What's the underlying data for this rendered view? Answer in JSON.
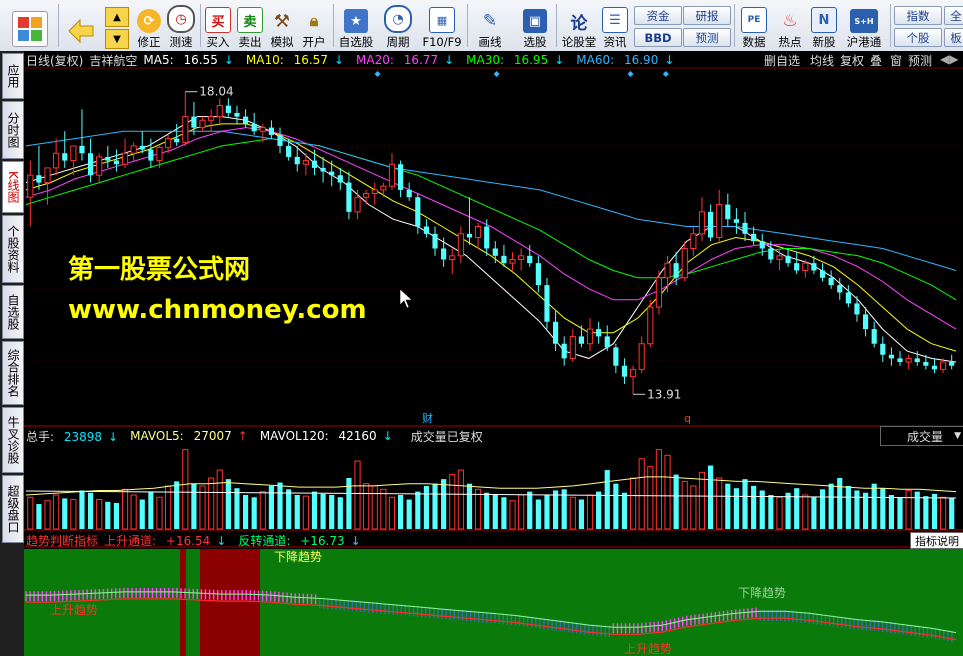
{
  "toolbar": {
    "main_menu": "",
    "buttons": [
      {
        "label": "",
        "icon": "back-icon"
      },
      {
        "label": "修正",
        "icon": "fix-icon"
      },
      {
        "label": "测速",
        "icon": "speedtest-icon"
      },
      {
        "label": "买入",
        "icon": "buy-icon",
        "glyph": "买"
      },
      {
        "label": "卖出",
        "icon": "sell-icon",
        "glyph": "卖"
      },
      {
        "label": "模拟",
        "icon": "hammer-icon"
      },
      {
        "label": "开户",
        "icon": "lock-icon"
      },
      {
        "label": "自选股",
        "icon": "star-icon"
      },
      {
        "label": "周期",
        "icon": "clock-icon"
      },
      {
        "label": "F10/F9",
        "icon": "f10-icon"
      },
      {
        "label": "画线",
        "icon": "pen-icon"
      },
      {
        "label": "选股",
        "icon": "select-icon"
      },
      {
        "label": "论股堂",
        "icon": "forum-icon",
        "glyph": "论"
      },
      {
        "label": "资讯",
        "icon": "news-icon"
      },
      {
        "label": "数据",
        "icon": "data-icon",
        "glyph": "PE"
      },
      {
        "label": "热点",
        "icon": "hot-icon"
      },
      {
        "label": "新股",
        "icon": "newstock-icon",
        "glyph": "N"
      },
      {
        "label": "沪港通",
        "icon": "hk-icon",
        "glyph": "S+H"
      }
    ],
    "small_buttons": [
      "资金",
      "研报",
      "BBD",
      "预测"
    ],
    "right_buttons": [
      "指数",
      "全",
      "个股",
      "板"
    ]
  },
  "left_tabs": [
    "应用",
    "分时图",
    "K线图",
    "个股资料",
    "自选股",
    "综合排名",
    "牛叉诊股",
    "超级盘口"
  ],
  "main": {
    "period": "日线(复权)",
    "stock": "吉祥航空",
    "ma": [
      {
        "label": "MA5:",
        "value": "16.55",
        "arrow": "↓",
        "color": "#ffffff"
      },
      {
        "label": "MA10:",
        "value": "16.57",
        "arrow": "↓",
        "color": "#ffff00"
      },
      {
        "label": "MA20:",
        "value": "16.77",
        "arrow": "↓",
        "color": "#ff44ff"
      },
      {
        "label": "MA30:",
        "value": "16.95",
        "arrow": "↓",
        "color": "#00ff00"
      },
      {
        "label": "MA60:",
        "value": "16.90",
        "arrow": "↓",
        "color": "#33b5ff"
      }
    ],
    "right_buttons": [
      "删自选",
      "均线",
      "复权",
      "叠",
      "窗",
      "预测"
    ],
    "high_label": "18.04",
    "low_label": "13.91",
    "marker_cai": "财",
    "marker_q": "q",
    "watermark_cn": "第一股票公式网",
    "watermark_url": "www.chnmoney.com"
  },
  "volume": {
    "total": {
      "label": "总手:",
      "value": "23898",
      "arrow": "↓"
    },
    "mavol5": {
      "label": "MAVOL5:",
      "value": "27007",
      "arrow": "↑"
    },
    "mavol120": {
      "label": "MAVOL120:",
      "value": "42160",
      "arrow": "↓"
    },
    "note": "成交量已复权",
    "selector": "成交量"
  },
  "indicator": {
    "name": "趋势判断指标",
    "up": {
      "label": "上升通道:",
      "value": "+16.54",
      "arrow": "↓"
    },
    "rev": {
      "label": "反转通道:",
      "value": "+16.73",
      "arrow": "↓"
    },
    "help": "指标说明",
    "labels": [
      "上升趋势",
      "下降趋势",
      "下降趋势",
      "上升趋势"
    ]
  },
  "chart_data": {
    "type": "candlestick",
    "price_range": [
      13.6,
      18.35
    ],
    "candles": [
      [
        16.6,
        17.1,
        16.2,
        16.9
      ],
      [
        16.9,
        17.3,
        16.7,
        16.8
      ],
      [
        16.8,
        17.0,
        16.5,
        17.0
      ],
      [
        17.0,
        17.4,
        16.9,
        17.2
      ],
      [
        17.2,
        17.5,
        17.0,
        17.1
      ],
      [
        17.1,
        17.3,
        16.9,
        17.3
      ],
      [
        17.3,
        17.8,
        17.1,
        17.2
      ],
      [
        17.2,
        17.4,
        16.8,
        16.9
      ],
      [
        16.9,
        17.2,
        16.8,
        17.15
      ],
      [
        17.15,
        17.3,
        17.0,
        17.1
      ],
      [
        17.1,
        17.25,
        16.95,
        17.05
      ],
      [
        17.05,
        17.4,
        17.0,
        17.2
      ],
      [
        17.2,
        17.35,
        17.1,
        17.3
      ],
      [
        17.3,
        17.5,
        17.2,
        17.25
      ],
      [
        17.25,
        17.4,
        17.0,
        17.1
      ],
      [
        17.1,
        17.3,
        17.0,
        17.28
      ],
      [
        17.28,
        17.45,
        17.2,
        17.4
      ],
      [
        17.4,
        17.6,
        17.3,
        17.35
      ],
      [
        17.35,
        18.04,
        17.3,
        17.7
      ],
      [
        17.7,
        17.9,
        17.45,
        17.55
      ],
      [
        17.55,
        17.7,
        17.5,
        17.65
      ],
      [
        17.65,
        17.8,
        17.5,
        17.7
      ],
      [
        17.7,
        17.95,
        17.6,
        17.85
      ],
      [
        17.85,
        17.95,
        17.7,
        17.75
      ],
      [
        17.75,
        17.85,
        17.6,
        17.7
      ],
      [
        17.7,
        17.8,
        17.55,
        17.6
      ],
      [
        17.6,
        17.75,
        17.45,
        17.5
      ],
      [
        17.5,
        17.6,
        17.35,
        17.55
      ],
      [
        17.55,
        17.65,
        17.4,
        17.45
      ],
      [
        17.45,
        17.55,
        17.2,
        17.3
      ],
      [
        17.3,
        17.4,
        17.1,
        17.15
      ],
      [
        17.15,
        17.3,
        16.95,
        17.05
      ],
      [
        17.05,
        17.2,
        16.9,
        17.1
      ],
      [
        17.1,
        17.25,
        16.9,
        17.0
      ],
      [
        17.0,
        17.15,
        16.8,
        16.95
      ],
      [
        16.95,
        17.1,
        16.75,
        16.9
      ],
      [
        16.9,
        17.0,
        16.7,
        16.8
      ],
      [
        16.8,
        16.95,
        16.3,
        16.4
      ],
      [
        16.4,
        16.7,
        16.3,
        16.6
      ],
      [
        16.6,
        16.7,
        16.5,
        16.65
      ],
      [
        16.65,
        16.8,
        16.5,
        16.7
      ],
      [
        16.7,
        16.8,
        16.6,
        16.75
      ],
      [
        16.75,
        17.2,
        16.7,
        17.05
      ],
      [
        17.05,
        17.1,
        16.6,
        16.7
      ],
      [
        16.7,
        16.8,
        16.55,
        16.6
      ],
      [
        16.6,
        16.65,
        16.1,
        16.2
      ],
      [
        16.2,
        16.3,
        16.05,
        16.1
      ],
      [
        16.1,
        16.2,
        15.8,
        15.9
      ],
      [
        15.9,
        16.05,
        15.65,
        15.75
      ],
      [
        15.75,
        15.9,
        15.55,
        15.8
      ],
      [
        15.8,
        16.2,
        15.7,
        16.1
      ],
      [
        16.1,
        16.6,
        15.95,
        16.05
      ],
      [
        16.05,
        16.25,
        15.9,
        16.2
      ],
      [
        16.2,
        16.3,
        15.8,
        15.9
      ],
      [
        15.9,
        16.0,
        15.7,
        15.8
      ],
      [
        15.8,
        15.95,
        15.65,
        15.7
      ],
      [
        15.7,
        15.85,
        15.6,
        15.75
      ],
      [
        15.75,
        15.9,
        15.6,
        15.8
      ],
      [
        15.8,
        15.95,
        15.65,
        15.7
      ],
      [
        15.7,
        15.8,
        15.3,
        15.4
      ],
      [
        15.4,
        15.5,
        14.8,
        14.9
      ],
      [
        14.9,
        15.05,
        14.5,
        14.6
      ],
      [
        14.6,
        14.7,
        14.3,
        14.4
      ],
      [
        14.4,
        14.8,
        14.35,
        14.7
      ],
      [
        14.7,
        14.85,
        14.55,
        14.6
      ],
      [
        14.6,
        14.95,
        14.5,
        14.8
      ],
      [
        14.8,
        14.9,
        14.6,
        14.7
      ],
      [
        14.7,
        14.85,
        14.5,
        14.55
      ],
      [
        14.55,
        14.6,
        14.2,
        14.3
      ],
      [
        14.3,
        14.4,
        14.05,
        14.15
      ],
      [
        14.15,
        14.3,
        13.91,
        14.25
      ],
      [
        14.25,
        14.7,
        14.2,
        14.6
      ],
      [
        14.6,
        15.2,
        14.55,
        15.1
      ],
      [
        15.1,
        15.6,
        15.0,
        15.5
      ],
      [
        15.5,
        15.8,
        15.3,
        15.7
      ],
      [
        15.7,
        15.85,
        15.4,
        15.5
      ],
      [
        15.5,
        16.0,
        15.45,
        15.9
      ],
      [
        15.9,
        16.2,
        15.8,
        16.1
      ],
      [
        16.1,
        16.6,
        16.0,
        16.4
      ],
      [
        16.4,
        16.5,
        16.0,
        16.05
      ],
      [
        16.05,
        16.7,
        16.0,
        16.5
      ],
      [
        16.5,
        16.65,
        16.2,
        16.3
      ],
      [
        16.3,
        16.45,
        16.1,
        16.25
      ],
      [
        16.25,
        16.4,
        16.0,
        16.1
      ],
      [
        16.1,
        16.2,
        15.95,
        16.0
      ],
      [
        16.0,
        16.1,
        15.8,
        15.9
      ],
      [
        15.9,
        16.0,
        15.7,
        15.75
      ],
      [
        15.75,
        15.9,
        15.6,
        15.8
      ],
      [
        15.8,
        15.9,
        15.65,
        15.7
      ],
      [
        15.7,
        15.85,
        15.55,
        15.6
      ],
      [
        15.6,
        15.75,
        15.5,
        15.7
      ],
      [
        15.7,
        15.8,
        15.55,
        15.6
      ],
      [
        15.6,
        15.7,
        15.45,
        15.5
      ],
      [
        15.5,
        15.6,
        15.35,
        15.4
      ],
      [
        15.4,
        15.5,
        15.2,
        15.3
      ],
      [
        15.3,
        15.4,
        15.1,
        15.15
      ],
      [
        15.15,
        15.25,
        14.9,
        15.0
      ],
      [
        15.0,
        15.1,
        14.7,
        14.8
      ],
      [
        14.8,
        14.9,
        14.55,
        14.6
      ],
      [
        14.6,
        14.7,
        14.35,
        14.45
      ],
      [
        14.45,
        14.55,
        14.3,
        14.4
      ],
      [
        14.4,
        14.5,
        14.3,
        14.35
      ],
      [
        14.35,
        14.45,
        14.25,
        14.4
      ],
      [
        14.4,
        14.5,
        14.3,
        14.35
      ],
      [
        14.35,
        14.45,
        14.25,
        14.3
      ],
      [
        14.3,
        14.4,
        14.2,
        14.25
      ],
      [
        14.25,
        14.4,
        14.2,
        14.35
      ],
      [
        14.35,
        14.45,
        14.25,
        14.3
      ]
    ],
    "ma_series": {
      "MA5": {
        "color": "#ffffff",
        "values": [
          16.8,
          16.9,
          17.0,
          17.1,
          17.2,
          17.3,
          17.5,
          17.7,
          17.7,
          17.65,
          17.5,
          17.3,
          17.0,
          16.8,
          16.5,
          16.3,
          16.2,
          16.0,
          15.8,
          15.5,
          15.2,
          14.9,
          14.5,
          14.4,
          14.6,
          15.1,
          15.6,
          16.0,
          16.2,
          16.2,
          16.0,
          15.8,
          15.7,
          15.5,
          15.2,
          14.8,
          14.5,
          14.4,
          14.35
        ]
      },
      "MA10": {
        "color": "#ffff00",
        "values": [
          16.7,
          16.8,
          16.95,
          17.05,
          17.15,
          17.25,
          17.4,
          17.55,
          17.6,
          17.6,
          17.5,
          17.35,
          17.15,
          16.95,
          16.75,
          16.55,
          16.4,
          16.2,
          16.0,
          15.8,
          15.55,
          15.25,
          14.95,
          14.75,
          14.75,
          14.95,
          15.3,
          15.7,
          15.95,
          16.05,
          16.0,
          15.9,
          15.8,
          15.65,
          15.4,
          15.1,
          14.8,
          14.6,
          14.5
        ]
      },
      "MA20": {
        "color": "#ff44ff",
        "values": [
          16.6,
          16.7,
          16.85,
          16.95,
          17.05,
          17.15,
          17.25,
          17.4,
          17.5,
          17.55,
          17.5,
          17.4,
          17.25,
          17.1,
          16.95,
          16.8,
          16.65,
          16.5,
          16.35,
          16.2,
          16.0,
          15.8,
          15.55,
          15.35,
          15.2,
          15.2,
          15.35,
          15.55,
          15.75,
          15.9,
          15.95,
          15.95,
          15.9,
          15.8,
          15.65,
          15.45,
          15.2,
          15.0,
          14.8
        ]
      },
      "MA30": {
        "color": "#00ff00",
        "values": [
          16.5,
          16.6,
          16.7,
          16.8,
          16.9,
          17.0,
          17.1,
          17.2,
          17.3,
          17.35,
          17.4,
          17.35,
          17.3,
          17.2,
          17.1,
          17.0,
          16.9,
          16.75,
          16.6,
          16.45,
          16.3,
          16.15,
          15.95,
          15.75,
          15.6,
          15.5,
          15.5,
          15.55,
          15.65,
          15.75,
          15.85,
          15.9,
          15.9,
          15.85,
          15.8,
          15.7,
          15.55,
          15.4,
          15.2
        ]
      },
      "MA60": {
        "color": "#33b5ff",
        "values": [
          17.3,
          17.35,
          17.4,
          17.45,
          17.5,
          17.5,
          17.5,
          17.5,
          17.5,
          17.45,
          17.4,
          17.35,
          17.3,
          17.2,
          17.1,
          17.0,
          16.95,
          16.9,
          16.85,
          16.8,
          16.75,
          16.7,
          16.6,
          16.5,
          16.4,
          16.3,
          16.25,
          16.2,
          16.2,
          16.2,
          16.15,
          16.1,
          16.05,
          16.0,
          15.95,
          15.9,
          15.8,
          15.7,
          15.6
        ]
      }
    },
    "volumes": [
      28,
      22,
      25,
      30,
      27,
      26,
      34,
      32,
      26,
      24,
      23,
      35,
      30,
      26,
      33,
      28,
      38,
      42,
      70,
      40,
      38,
      45,
      52,
      44,
      36,
      30,
      28,
      33,
      38,
      41,
      35,
      30,
      29,
      33,
      31,
      30,
      28,
      45,
      60,
      40,
      38,
      35,
      28,
      30,
      26,
      33,
      38,
      40,
      44,
      48,
      52,
      40,
      35,
      32,
      30,
      28,
      25,
      30,
      33,
      26,
      30,
      34,
      35,
      28,
      26,
      30,
      33,
      52,
      40,
      32,
      45,
      62,
      55,
      70,
      65,
      48,
      42,
      38,
      50,
      56,
      45,
      40,
      36,
      44,
      38,
      34,
      30,
      28,
      32,
      36,
      30,
      28,
      35,
      40,
      45,
      38,
      34,
      32,
      40,
      36,
      30,
      28,
      34,
      33,
      29,
      31,
      28,
      27
    ],
    "mavol_values": [
      30,
      31,
      32,
      33,
      34,
      34,
      35,
      36,
      38,
      40,
      40,
      41,
      40,
      39,
      38,
      37,
      37,
      37,
      38,
      38,
      39,
      40,
      40,
      39,
      38,
      37,
      36,
      36,
      36,
      37,
      38,
      40,
      42,
      44,
      46,
      46,
      45,
      44,
      43,
      42,
      42,
      41,
      40,
      39,
      38,
      37,
      36,
      36,
      35,
      35,
      34,
      33
    ],
    "indicator_up": [
      0.55,
      0.55,
      0.56,
      0.57,
      0.58,
      0.58,
      0.58,
      0.57,
      0.56,
      0.56,
      0.55,
      0.53,
      0.52,
      0.5,
      0.48,
      0.46,
      0.44,
      0.42,
      0.4,
      0.38,
      0.36,
      0.33,
      0.3,
      0.27,
      0.25,
      0.25,
      0.27,
      0.32,
      0.35,
      0.38,
      0.4,
      0.4,
      0.38,
      0.35,
      0.32,
      0.3,
      0.27,
      0.24,
      0.2
    ]
  }
}
